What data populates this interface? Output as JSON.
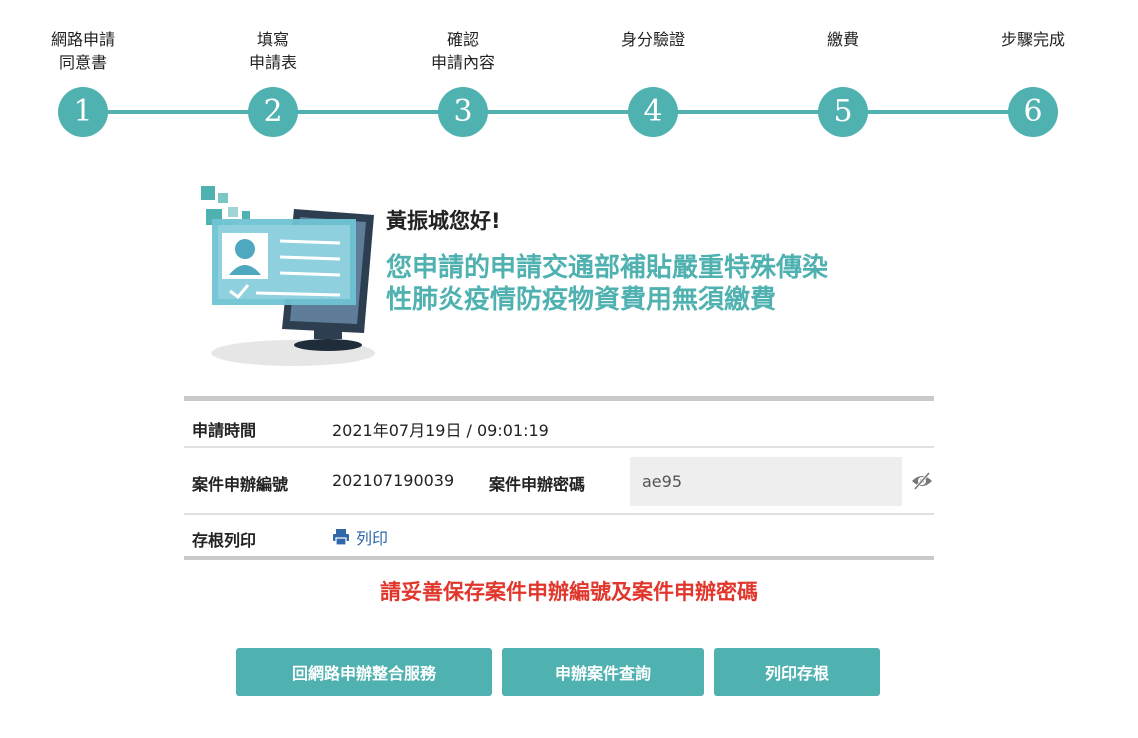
{
  "steps": [
    {
      "label": "網路申請\n同意書",
      "number": "1"
    },
    {
      "label": "填寫\n申請表",
      "number": "2"
    },
    {
      "label": "確認\n申請內容",
      "number": "3"
    },
    {
      "label": "身分驗證",
      "number": "4"
    },
    {
      "label": "繳費",
      "number": "5"
    },
    {
      "label": "步驟完成",
      "number": "6"
    }
  ],
  "greeting": "黃振城您好!",
  "headline": "您申請的申請交通部補貼嚴重特殊傳染\n性肺炎疫情防疫物資費用無須繳費",
  "info": {
    "time_label": "申請時間",
    "time_value": "2021年07月19日 / 09:01:19",
    "case_no_label": "案件申辦編號",
    "case_no_value": "202107190039",
    "password_label": "案件申辦密碼",
    "password_value": "ae95",
    "print_label": "存根列印",
    "print_link": "列印"
  },
  "warning": "請妥善保存案件申辦編號及案件申辦密碼",
  "buttons": {
    "back": "回網路申辦整合服務",
    "query": "申辦案件查詢",
    "print": "列印存根"
  },
  "colors": {
    "accent": "#4fb1b0",
    "warning": "#e0362c",
    "link": "#2f67a8"
  },
  "icons": [
    "monitor-id-card-illustration",
    "eye-slash-icon",
    "printer-icon"
  ]
}
